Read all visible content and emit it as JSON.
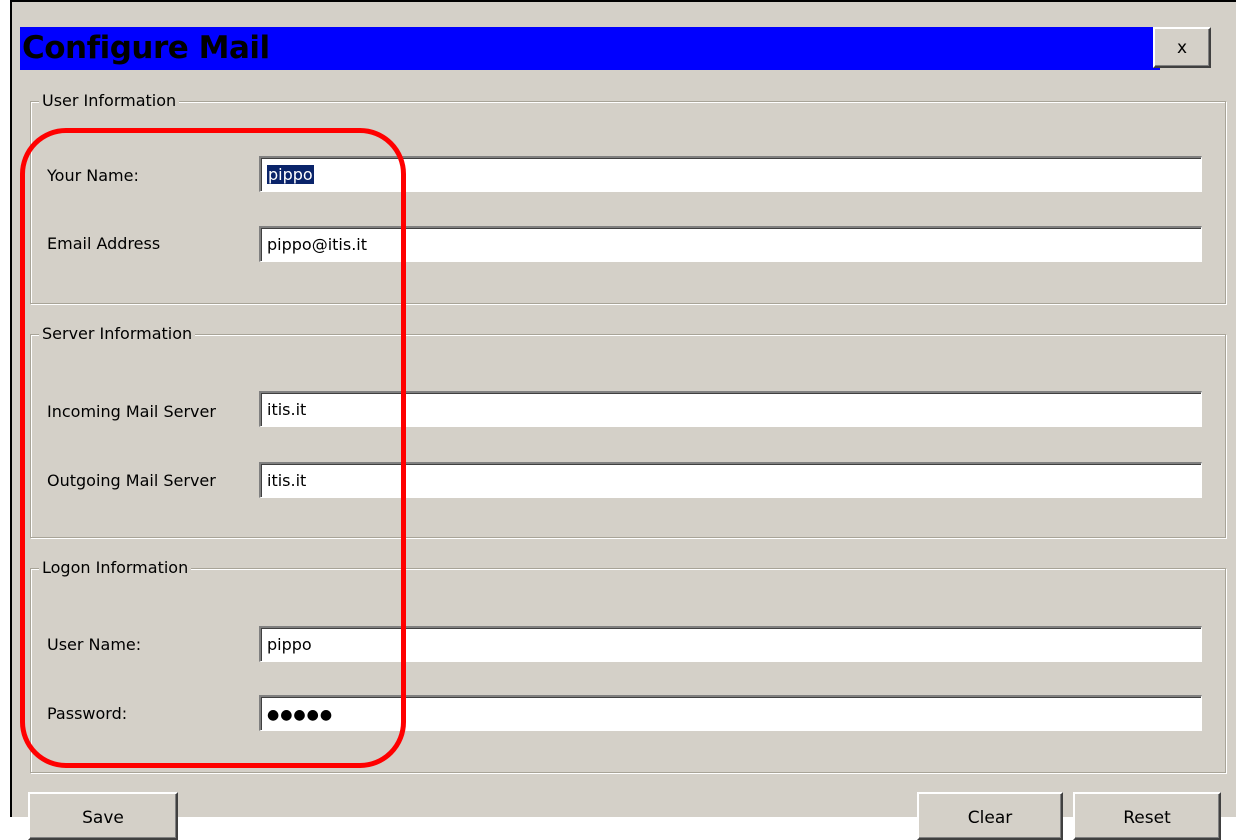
{
  "window": {
    "title": "Configure Mail",
    "close_label": "x"
  },
  "user_info": {
    "legend": "User Information",
    "name_label": "Your Name:",
    "name_value": "pippo",
    "email_label": "Email Address",
    "email_value": "pippo@itis.it"
  },
  "server_info": {
    "legend": "Server Information",
    "incoming_label": "Incoming Mail Server",
    "incoming_value": "itis.it",
    "outgoing_label": "Outgoing Mail Server",
    "outgoing_value": "itis.it"
  },
  "logon_info": {
    "legend": "Logon Information",
    "username_label": "User Name:",
    "username_value": "pippo",
    "password_label": "Password:",
    "password_masked": "●●●●●"
  },
  "buttons": {
    "save": "Save",
    "clear": "Clear",
    "reset": "Reset"
  },
  "colors": {
    "title_bar": "#0000ff",
    "dialog_bg": "#d4d0c8",
    "highlight": "#ff0000",
    "selection": "#0a246a"
  }
}
